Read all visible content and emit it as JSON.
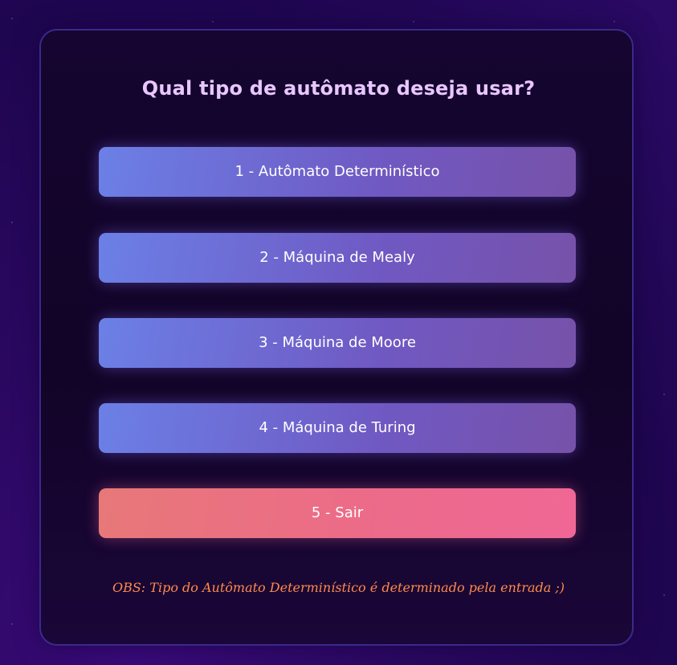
{
  "title": "Qual tipo de autômato deseja usar?",
  "options": [
    {
      "label": "1 - Autômato Determinístico"
    },
    {
      "label": "2 - Máquina de Mealy"
    },
    {
      "label": "3 - Máquina de Moore"
    },
    {
      "label": "4 - Máquina de Turing"
    },
    {
      "label": "5 - Sair"
    }
  ],
  "note": "OBS: Tipo do Autômato Determinístico é determinado pela entrada ;)",
  "colors": {
    "background": "#2a0860",
    "card": "#150530",
    "title": "#e9c6ff",
    "button_start": "#6b80e6",
    "button_end": "#7752a9",
    "exit_start": "#e87878",
    "exit_end": "#f06796",
    "note": "#ff8a4a"
  }
}
